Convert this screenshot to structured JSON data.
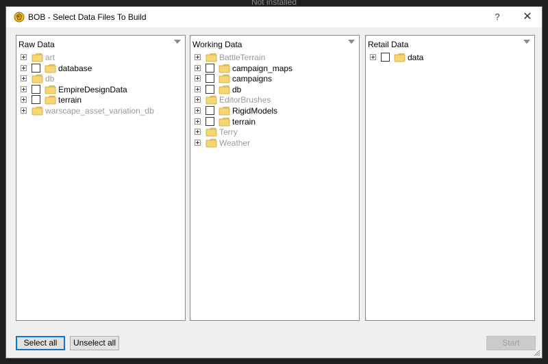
{
  "background_caption": "Not installed",
  "window": {
    "title": "BOB - Select Data Files To Build",
    "help_label": "?",
    "close_label": "✕"
  },
  "panels": [
    {
      "header": "Raw Data",
      "items": [
        {
          "label": "art",
          "checkbox": false,
          "disabled": true
        },
        {
          "label": "database",
          "checkbox": true,
          "disabled": false
        },
        {
          "label": "db",
          "checkbox": false,
          "disabled": true
        },
        {
          "label": "EmpireDesignData",
          "checkbox": true,
          "disabled": false
        },
        {
          "label": "terrain",
          "checkbox": true,
          "disabled": false
        },
        {
          "label": "warscape_asset_variation_db",
          "checkbox": false,
          "disabled": true
        }
      ]
    },
    {
      "header": "Working Data",
      "items": [
        {
          "label": "BattleTerrain",
          "checkbox": false,
          "disabled": true
        },
        {
          "label": "campaign_maps",
          "checkbox": true,
          "disabled": false
        },
        {
          "label": "campaigns",
          "checkbox": true,
          "disabled": false
        },
        {
          "label": "db",
          "checkbox": true,
          "disabled": false
        },
        {
          "label": "EditorBrushes",
          "checkbox": false,
          "disabled": true
        },
        {
          "label": "RigidModels",
          "checkbox": true,
          "disabled": false
        },
        {
          "label": "terrain",
          "checkbox": true,
          "disabled": false
        },
        {
          "label": "Terry",
          "checkbox": false,
          "disabled": true
        },
        {
          "label": "Weather",
          "checkbox": false,
          "disabled": true
        }
      ]
    },
    {
      "header": "Retail Data",
      "items": [
        {
          "label": "data",
          "checkbox": true,
          "disabled": false
        }
      ]
    }
  ],
  "buttons": {
    "select_all": "Select all",
    "unselect_all": "Unselect all",
    "start": "Start"
  },
  "colors": {
    "folder_fill": "#f7d774",
    "folder_edge": "#c9a43b",
    "accent": "#0078d7",
    "disabled_text": "#9a9a9a"
  }
}
